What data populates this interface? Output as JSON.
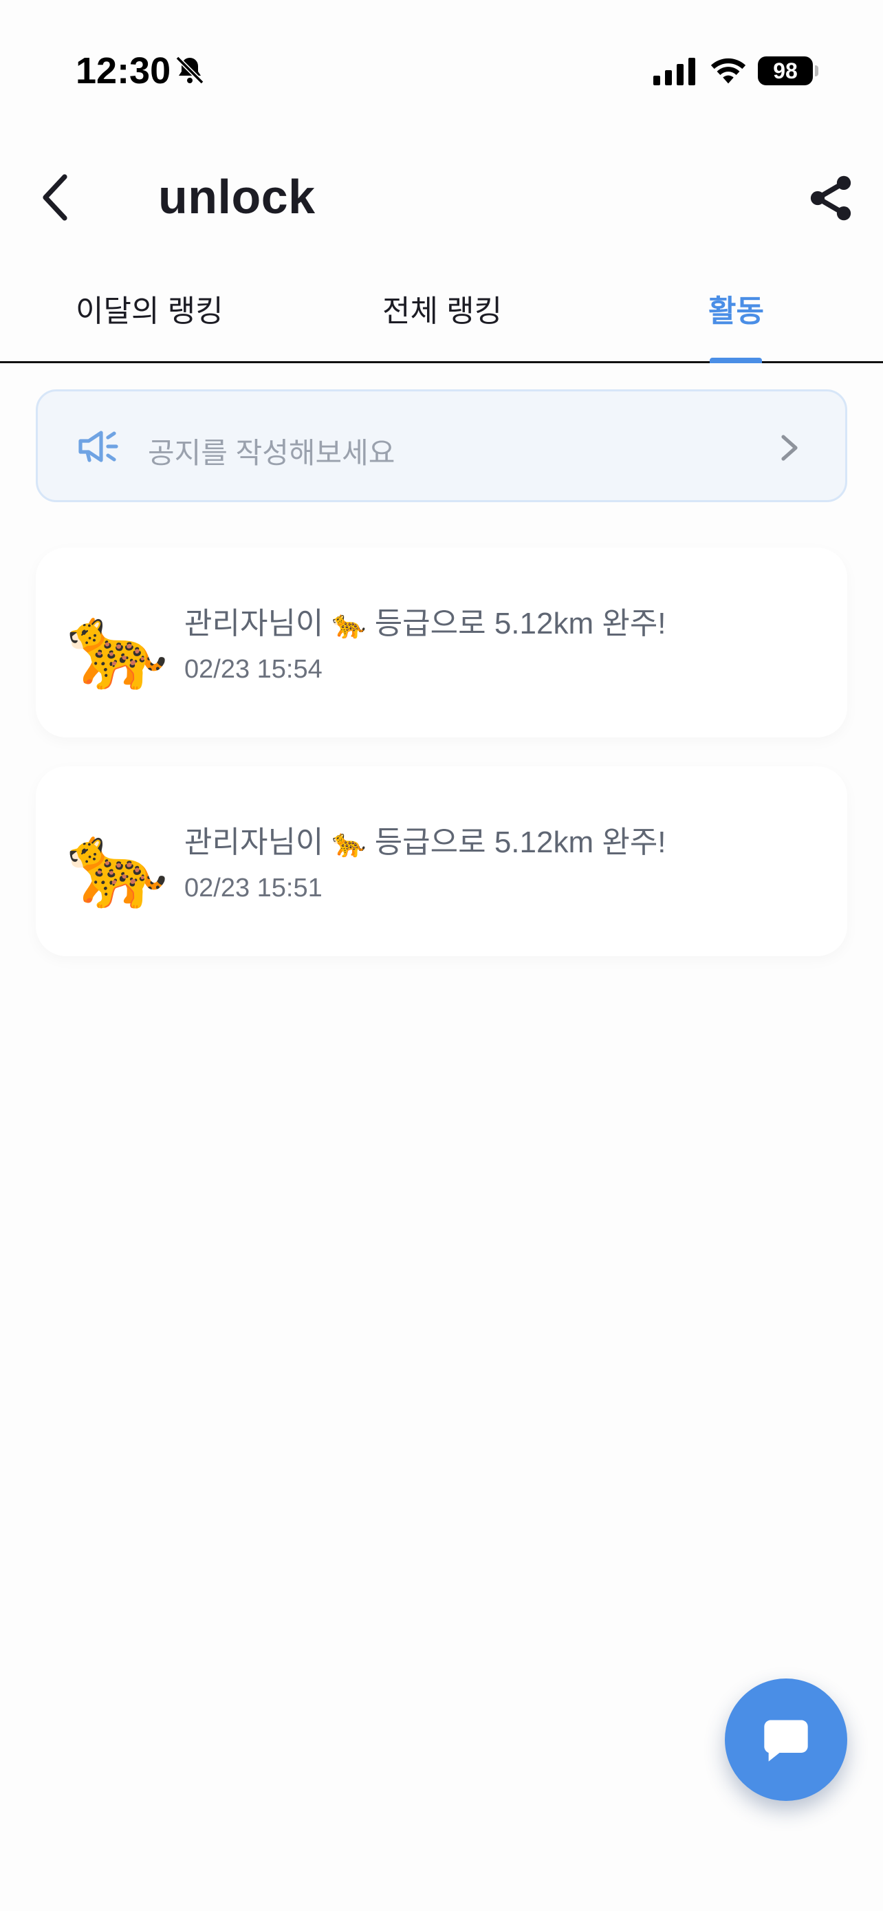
{
  "status_bar": {
    "time": "12:30",
    "battery": "98",
    "icons": [
      "bell-slash-icon",
      "cellular-signal-icon",
      "wifi-icon",
      "battery-icon"
    ]
  },
  "header": {
    "title": "unlock",
    "back_icon": "chevron-left-icon",
    "share_icon": "share-icon"
  },
  "tabs": [
    {
      "label": "이달의 랭킹",
      "active": false
    },
    {
      "label": "전체 랭킹",
      "active": false
    },
    {
      "label": "활동",
      "active": true
    }
  ],
  "notice": {
    "placeholder": "공지를 작성해보세요",
    "icon": "megaphone-icon",
    "chevron": "chevron-right-icon"
  },
  "activities": [
    {
      "avatar": "🐆",
      "message_prefix": "관리자님이",
      "grade_emoji": "🐆",
      "message_suffix": "등급으로 5.12km 완주!",
      "time": "02/23 15:54"
    },
    {
      "avatar": "🐆",
      "message_prefix": "관리자님이",
      "grade_emoji": "🐆",
      "message_suffix": "등급으로 5.12km 완주!",
      "time": "02/23 15:51"
    }
  ],
  "fab": {
    "icon": "chat-bubble-icon"
  },
  "colors": {
    "accent": "#4a8ee6",
    "notice_bg": "#f2f6fb",
    "notice_border": "#d7e6f8",
    "muted_text": "#9aa1ad",
    "body_text": "#5f6673"
  }
}
